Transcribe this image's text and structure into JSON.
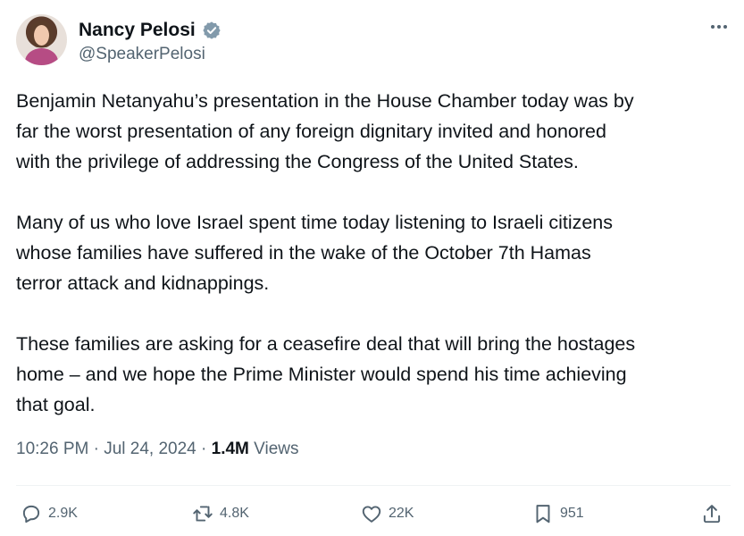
{
  "author": {
    "display_name": "Nancy Pelosi",
    "handle": "@SpeakerPelosi",
    "verified_badge_color": "#829aab"
  },
  "tweet": {
    "paragraphs": [
      "Benjamin Netanyahu’s presentation in the House Chamber today was by\nfar the worst presentation of any foreign dignitary invited and honored\nwith the privilege of addressing the Congress of the United States.",
      "Many of us who love Israel spent time today listening to Israeli citizens\nwhose families have suffered in the wake of the October 7th Hamas\nterror attack and kidnappings.",
      "These families are asking for a ceasefire deal that will bring the hostages\nhome – and we hope the Prime Minister would spend his time achieving\nthat goal."
    ],
    "time": "10:26 PM",
    "date": "Jul 24, 2024",
    "views_count": "1.4M",
    "views_label": "Views"
  },
  "actions": {
    "replies": "2.9K",
    "reposts": "4.8K",
    "likes": "22K",
    "bookmarks": "951"
  },
  "icons": {
    "more": "more-horizontal-icon",
    "reply": "reply-icon",
    "repost": "repost-icon",
    "like": "heart-icon",
    "bookmark": "bookmark-icon",
    "share": "share-icon"
  },
  "colors": {
    "text_primary": "#0f1419",
    "text_secondary": "#536471",
    "divider": "#eff3f4"
  }
}
